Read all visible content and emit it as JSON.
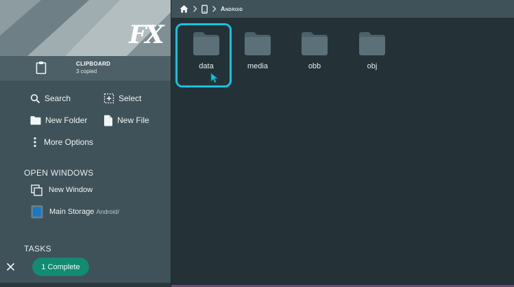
{
  "sidebar": {
    "logo_text": "FX",
    "clipboard": {
      "title": "CLIPBOARD",
      "subtitle": "3 copied"
    },
    "actions": [
      {
        "label": "Search",
        "icon": "search-icon"
      },
      {
        "label": "Select",
        "icon": "select-icon"
      },
      {
        "label": "New Folder",
        "icon": "folder-icon"
      },
      {
        "label": "New File",
        "icon": "file-icon"
      },
      {
        "label": "More Options",
        "icon": "more-vert-icon"
      }
    ],
    "open_windows": {
      "heading": "OPEN WINDOWS",
      "items": [
        {
          "label": "New Window",
          "sub": "",
          "icon": "new-window-icon"
        },
        {
          "label": "Main Storage",
          "sub": "Android/",
          "icon": "storage-icon"
        }
      ]
    },
    "tasks": {
      "heading": "TASKS",
      "complete_label": "1 Complete"
    }
  },
  "breadcrumb": {
    "current": "Android"
  },
  "folders": [
    {
      "name": "data",
      "selected": true
    },
    {
      "name": "media",
      "selected": false
    },
    {
      "name": "obb",
      "selected": false
    },
    {
      "name": "obj",
      "selected": false
    }
  ],
  "colors": {
    "accent": "#16c3e0",
    "sidebar_bg": "#3f5259",
    "main_bg": "#243237",
    "folder": "#5b7079",
    "complete_pill": "#138a72"
  }
}
